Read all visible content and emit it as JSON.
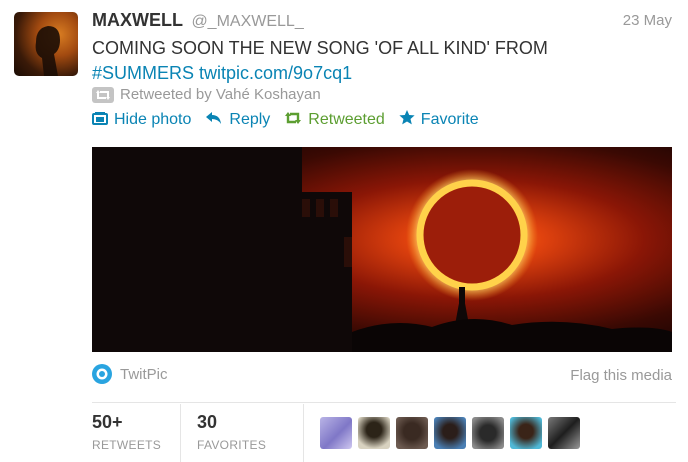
{
  "tweet": {
    "author_name": "MAXWELL",
    "author_handle": "@_MAXWELL_",
    "date": "23 May",
    "text_line1": "COMING SOON THE NEW SONG 'OF ALL KIND' FROM",
    "hashtag": "#SUMMERS",
    "link": "twitpic.com/9o7cq1",
    "retweeted_by": "Retweeted by Vahé Koshayan"
  },
  "actions": {
    "hide_photo": "Hide photo",
    "reply": "Reply",
    "retweeted": "Retweeted",
    "favorite": "Favorite"
  },
  "media": {
    "source": "TwitPic",
    "flag": "Flag this media"
  },
  "stats": {
    "retweets_count": "50+",
    "retweets_label": "RETWEETS",
    "favorites_count": "30",
    "favorites_label": "FAVORITES"
  },
  "colors": {
    "link": "#0a84b4",
    "retweeted_green": "#5c9e31",
    "muted": "#999999"
  }
}
